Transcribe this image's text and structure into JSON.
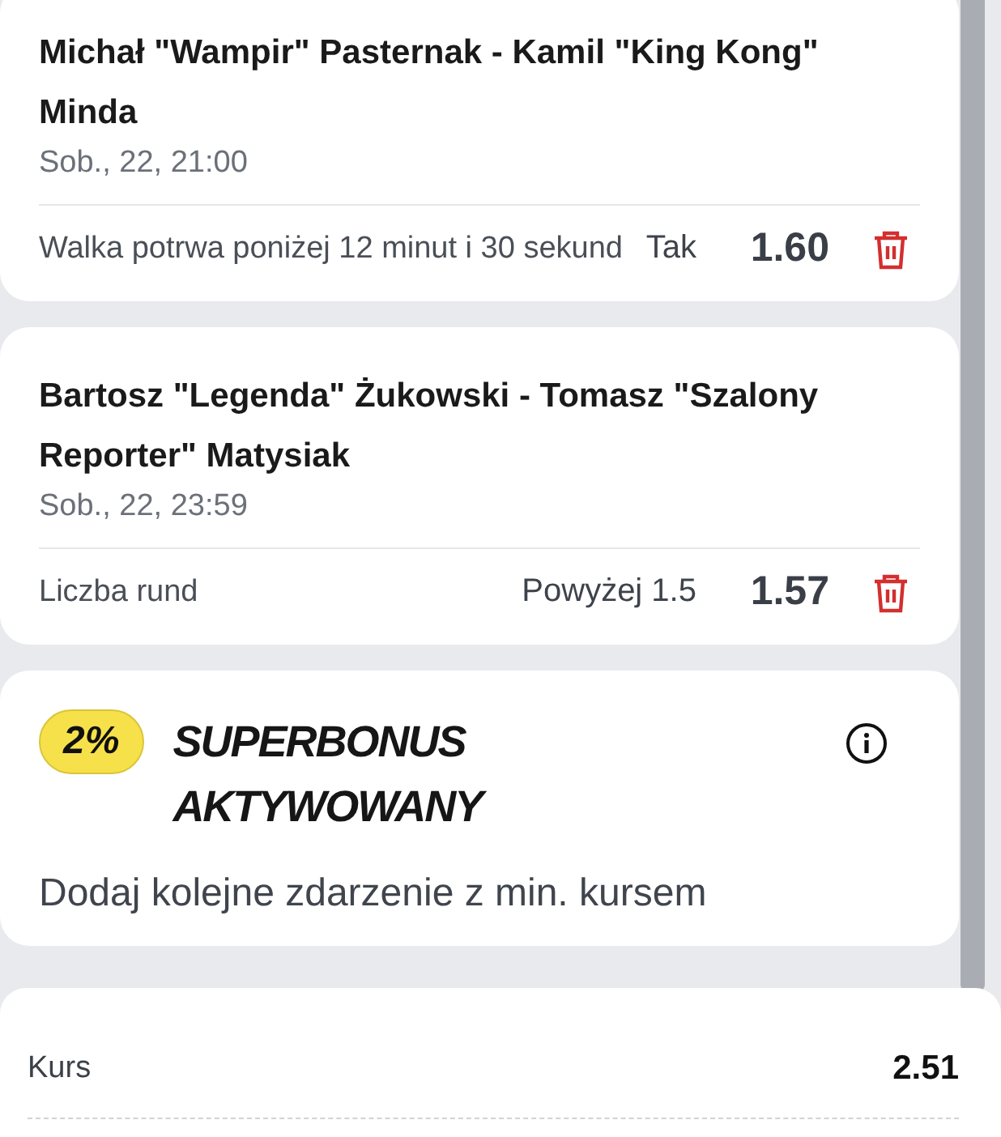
{
  "bets": [
    {
      "event": "Michał \"Wampir\" Pasternak - Kamil \"King Kong\" Minda",
      "date": "Sob., 22, 21:00",
      "market": "Walka potrwa poniżej 12 minut i 30 sekund",
      "selection": "Tak",
      "odds": "1.60"
    },
    {
      "event": "Bartosz \"Legenda\" Żukowski - Tomasz \"Szalony Reporter\" Matysiak",
      "date": "Sob., 22, 23:59",
      "market": "Liczba rund",
      "selection": "Powyżej 1.5",
      "odds": "1.57"
    }
  ],
  "superbonus": {
    "badge": "2%",
    "title": "SUPERBONUS AKTYWOWANY",
    "text": "Dodaj kolejne zdarzenie z min. kursem"
  },
  "summary": {
    "label": "Kurs",
    "value": "2.51"
  }
}
